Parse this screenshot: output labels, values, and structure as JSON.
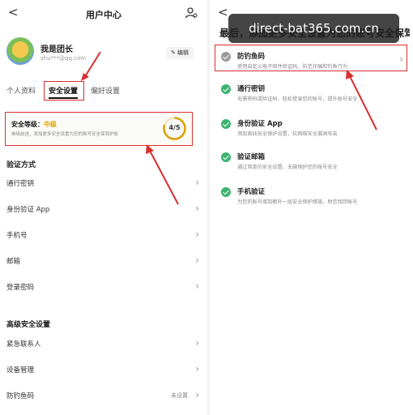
{
  "left": {
    "back": "<",
    "title": "用户中心",
    "user": {
      "name": "我是团长",
      "email": "shu***@qq.com"
    },
    "edit_label": "编辑",
    "tabs": [
      {
        "label": "个人资料"
      },
      {
        "label": "安全设置"
      },
      {
        "label": "偏好设置"
      }
    ],
    "security": {
      "label": "安全等级：",
      "level": "中级",
      "desc": "继续前进，添加更多安全设置为您的账号安全保驾护航",
      "score": "4/5",
      "score_fraction": 0.8
    },
    "verify_heading": "验证方式",
    "verify_items": [
      {
        "label": "通行密钥"
      },
      {
        "label": "身份验证 App"
      },
      {
        "label": "手机号"
      },
      {
        "label": "邮箱"
      },
      {
        "label": "登录密码"
      }
    ],
    "advanced_heading": "高级安全设置",
    "advanced_items": [
      {
        "label": "紧急联系人",
        "value": ""
      },
      {
        "label": "设备管理",
        "value": ""
      },
      {
        "label": "防钓鱼码",
        "value": "未设置"
      }
    ]
  },
  "right": {
    "back": "<",
    "title": "最后，添加更多安全设置为您的账号安全保驾护",
    "watermark": "direct-bat365.com.cn",
    "options": [
      {
        "title": "防钓鱼码",
        "desc": "使用自定义电子邮件验证码，防范诈骗和钓鱼行为",
        "status": "gray"
      },
      {
        "title": "通行密钥",
        "desc": "无需密码或验证码，轻松登录您的账号，提升账号安全",
        "status": "green"
      },
      {
        "title": "身份验证 App",
        "desc": "添加离线安全保护设置，抗网络安全漏洞攻击",
        "status": "green"
      },
      {
        "title": "验证邮箱",
        "desc": "通过简单的安全设置，无缝保护您的账号安全",
        "status": "green"
      },
      {
        "title": "手机验证",
        "desc": "为您的账号增加额外一层安全保护措施，助您找回账号",
        "status": "green"
      }
    ]
  },
  "colors": {
    "highlight": "#d92e2e",
    "level": "#d9a400",
    "ok": "#3cb371",
    "pending": "#9a9a9a"
  }
}
